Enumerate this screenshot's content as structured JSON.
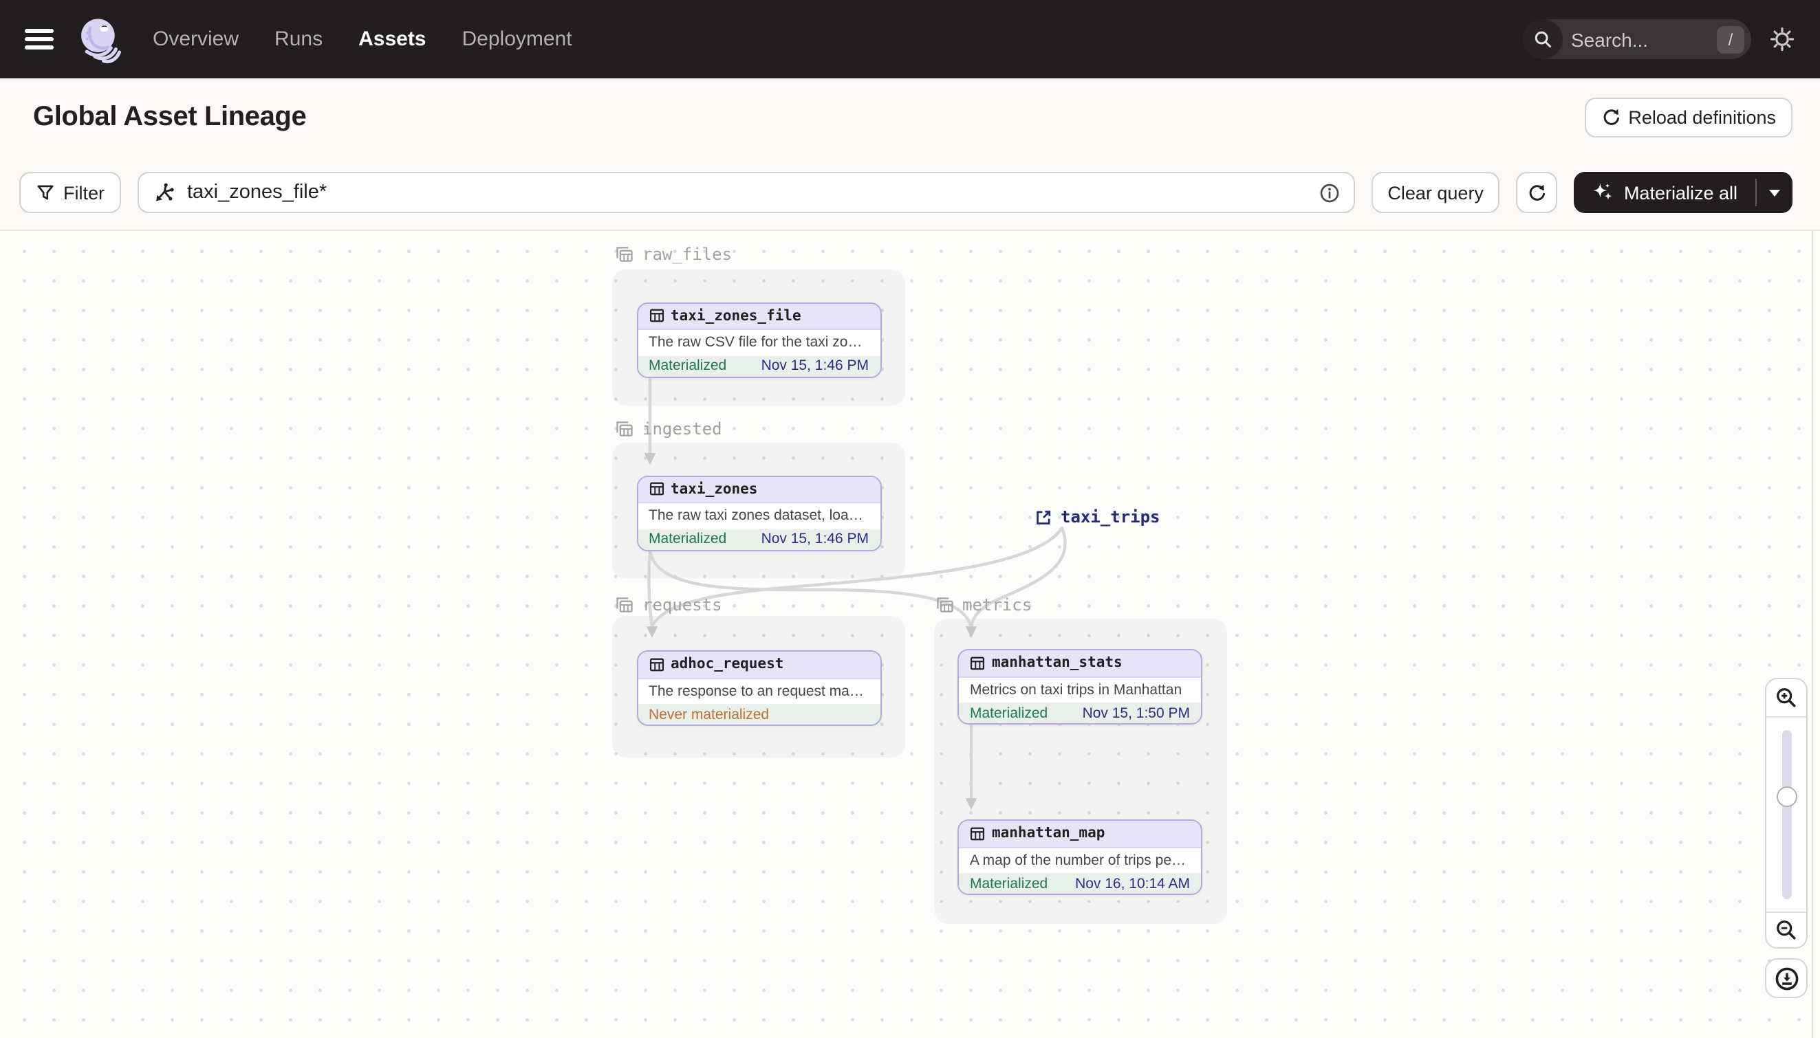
{
  "topbar": {
    "nav_items": [
      {
        "label": "Overview",
        "active": false
      },
      {
        "label": "Runs",
        "active": false
      },
      {
        "label": "Assets",
        "active": true
      },
      {
        "label": "Deployment",
        "active": false
      }
    ],
    "search": {
      "placeholder": "Search...",
      "shortcut": "/"
    }
  },
  "page_header": {
    "title": "Global Asset Lineage",
    "reload_button": "Reload definitions"
  },
  "query_toolbar": {
    "filter_button": "Filter",
    "query_input_value": "taxi_zones_file*",
    "clear_button": "Clear query",
    "materialize_button": "Materialize all"
  },
  "lineage_graph": {
    "groups": [
      {
        "name": "raw_files"
      },
      {
        "name": "ingested"
      },
      {
        "name": "requests"
      },
      {
        "name": "metrics"
      }
    ],
    "nodes": [
      {
        "name": "taxi_zones_file",
        "group": "raw_files",
        "description": "The raw CSV file for the taxi zones dat...",
        "status": "Materialized",
        "timestamp": "Nov 15, 1:46 PM"
      },
      {
        "name": "taxi_zones",
        "group": "ingested",
        "description": "The raw taxi zones dataset, loaded int...",
        "status": "Materialized",
        "timestamp": "Nov 15, 1:46 PM"
      },
      {
        "name": "adhoc_request",
        "group": "requests",
        "description": "The response to an request made in th...",
        "status": "Never materialized",
        "timestamp": ""
      },
      {
        "name": "manhattan_stats",
        "group": "metrics",
        "description": "Metrics on taxi trips in Manhattan",
        "status": "Materialized",
        "timestamp": "Nov 15, 1:50 PM"
      },
      {
        "name": "manhattan_map",
        "group": "metrics",
        "description": "A map of the number of trips per taxi z...",
        "status": "Materialized",
        "timestamp": "Nov 16, 10:14 AM"
      }
    ],
    "external_nodes": [
      {
        "name": "taxi_trips"
      }
    ],
    "edges": [
      {
        "from": "taxi_zones_file",
        "to": "taxi_zones"
      },
      {
        "from": "taxi_zones",
        "to": "adhoc_request"
      },
      {
        "from": "taxi_zones",
        "to": "manhattan_stats"
      },
      {
        "from": "taxi_trips",
        "to": "adhoc_request"
      },
      {
        "from": "taxi_trips",
        "to": "manhattan_stats"
      },
      {
        "from": "manhattan_stats",
        "to": "manhattan_map"
      }
    ]
  },
  "colors": {
    "topbar_bg": "#221e20",
    "node_border_purple": "#b2aae0",
    "node_header_lavender": "#e8e4f8",
    "materialized_green": "#1c7a50",
    "never_materialized_orange": "#bd7133",
    "timestamp_navy": "#282d8f",
    "external_node_navy": "#232a7c",
    "edge_gray": "#d8d6d8"
  }
}
